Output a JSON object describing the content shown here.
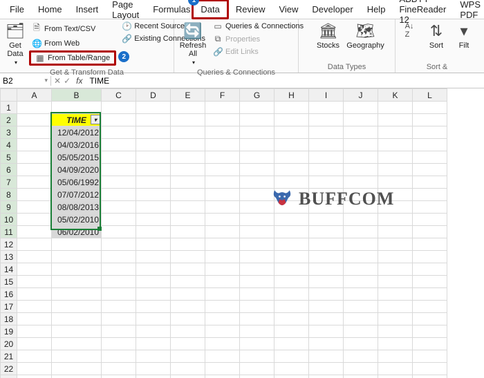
{
  "tabs": [
    "File",
    "Home",
    "Insert",
    "Page Layout",
    "Formulas",
    "Data",
    "Review",
    "View",
    "Developer",
    "Help",
    "ABBYY FineReader 12",
    "WPS PDF"
  ],
  "active_tab_index": 5,
  "callouts": {
    "data_tab": "1",
    "from_table_range": "2"
  },
  "ribbon": {
    "get_transform": {
      "get_data": "Get Data",
      "from_text_csv": "From Text/CSV",
      "from_web": "From Web",
      "from_table_range": "From Table/Range",
      "recent_sources": "Recent Sources",
      "existing_connections": "Existing Connections",
      "group_label": "Get & Transform Data"
    },
    "queries": {
      "refresh_all": "Refresh All",
      "queries_connections": "Queries & Connections",
      "properties": "Properties",
      "edit_links": "Edit Links",
      "group_label": "Queries & Connections"
    },
    "data_types": {
      "stocks": "Stocks",
      "geography": "Geography",
      "group_label": "Data Types"
    },
    "sort_filter": {
      "sort": "Sort",
      "filter": "Filt",
      "group_label": "Sort &"
    }
  },
  "formula_bar": {
    "name_box": "B2",
    "fx_label": "fx",
    "value": "TIME"
  },
  "columns": [
    "A",
    "B",
    "C",
    "D",
    "E",
    "F",
    "G",
    "H",
    "I",
    "J",
    "K",
    "L"
  ],
  "row_count": 23,
  "table": {
    "header": "TIME",
    "rows": [
      "12/04/2012",
      "04/03/2016",
      "05/05/2015",
      "04/09/2020",
      "05/06/1992",
      "07/07/2012",
      "08/08/2013",
      "05/02/2010",
      "06/02/2010"
    ]
  },
  "selection": {
    "ref": "B2:B11",
    "col_index": 1,
    "row_start": 2,
    "row_end": 11
  },
  "watermark": "BUFFCOM"
}
